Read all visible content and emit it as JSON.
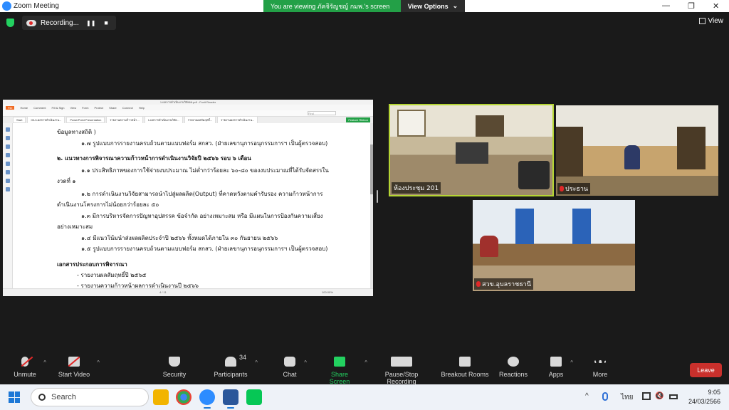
{
  "window": {
    "title": "Zoom Meeting",
    "viewing_banner": "You are viewing ภัคจิรัญชญ์ กมพ.'s screen",
    "view_options": "View Options",
    "minimize": "—",
    "restore": "❐",
    "close": "✕"
  },
  "topbar": {
    "recording_label": "Recording...",
    "pause_icon": "❚❚",
    "stop_icon": "■",
    "view_label": "View"
  },
  "shared_document": {
    "title": "1-ผลการดำเนินงานวิจัย66.pdf - Foxit Reader",
    "menu": [
      "File",
      "Home",
      "Comment",
      "Fill & Sign",
      "View",
      "Form",
      "Protect",
      "Share",
      "Connect",
      "Help"
    ],
    "search_placeholder": "Find",
    "tabs": [
      "Start",
      "05-3-ผลการดำเนินงาน...",
      "PowerPoint Presentation",
      "รายงานความก้าวหน้า...",
      "1-ผลการดำเนินงานวิจัย...",
      "รายงานผลสัมฤทธิ์...",
      "รายงานผลการดำเนินงาน..."
    ],
    "fn_button": "Feature Ribbon",
    "lines": [
      "ข้อมูลทางสถิติ )",
      "๑.๗ รูปแบบการรายงานครบถ้วนตามแบบฟอร์ม สกสว. (ฝ่ายเลขานุการอนุกรรมการฯ เป็นผู้ตรวจสอบ)",
      "๒. แนวทางการพิจารณาความก้าวหน้าการดำเนินงานวิจัยปี ๒๕๖๖ รอบ ๖ เดือน",
      "๑.๑ ประสิทธิภาพของการใช้จ่ายงบประมาณ ไม่ต่ำกว่าร้อยละ ๖๐-๘๐ ของงบประมาณที่ได้รับจัดสรรใน",
      "งวดที่ ๑",
      "๑.๒ การดำเนินงานวิจัยสามารถนำไปสู่ผลผลิต(Output) ที่คาดหวังตามคำรับรอง ความก้าวหน้าการ",
      "ดำเนินงานโครงการไม่น้อยกว่าร้อยละ ๕๐",
      "๑.๓ มีการบริหารจัดการปัญหาอุปสรรค ข้อจำกัด อย่างเหมาะสม หรือ มีแผนในการป้องกันความเสี่ยง",
      "อย่างเหมาะสม",
      "๑.๔ มีแนวโน้มนำส่งผลผลิตประจำปี ๒๕๖๖ ทั้งหมดได้ภายใน ๓๐ กันยายน ๒๕๖๖",
      "๑.๕ รูปแบบการรายงานครบถ้วนตามแบบฟอร์ม สกสว. (ฝ่ายเลขานุการอนุกรรมการฯ เป็นผู้ตรวจสอบ)",
      "เอกสารประกอบการพิจารณา",
      "- รายงานผลสัมฤทธิ์ปี ๒๕๖๕",
      "- รายงานความก้าวหน้าผลการดำเนินงานปี ๒๕๖๖"
    ],
    "pager": "4 / 11",
    "zoom": "100.00%"
  },
  "participants_tiles": [
    {
      "name": "ห้องประชุม 201"
    },
    {
      "name": "ประธาน"
    },
    {
      "name": "สวข.อุบลราชธานี"
    }
  ],
  "toolbar": {
    "unmute": "Unmute",
    "start_video": "Start Video",
    "security": "Security",
    "participants": "Participants",
    "participants_count": "34",
    "chat": "Chat",
    "share_screen": "Share Screen",
    "pause_stop_recording": "Pause/Stop Recording",
    "breakout_rooms": "Breakout Rooms",
    "reactions": "Reactions",
    "apps": "Apps",
    "more": "More",
    "leave": "Leave",
    "caret": "^"
  },
  "taskbar": {
    "search_label": "Search",
    "tray_caret": "^",
    "language": "ไทย",
    "time": "9:05",
    "date": "24/03/2566"
  },
  "colors": {
    "zoom_blue": "#2d8cff",
    "banner_green": "#23a047",
    "active_speaker": "#b5d534",
    "leave_red": "#c9302c",
    "foxit_orange": "#f06a22"
  }
}
